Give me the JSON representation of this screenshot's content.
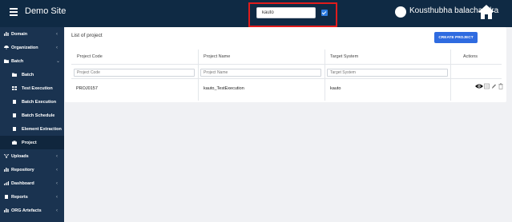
{
  "header": {
    "app_title": "Demo Site",
    "search": {
      "value": "kauto",
      "placeholder": ""
    },
    "checkbox_checked": true,
    "username": "Kousthubha balachandra"
  },
  "sidebar": {
    "items": [
      {
        "label": "Domain",
        "icon": "bar-chart-icon",
        "chevron": "‹"
      },
      {
        "label": "Organization",
        "icon": "umbrella-icon",
        "chevron": "‹"
      },
      {
        "label": "Batch",
        "icon": "folder-icon",
        "chevron": "⌄"
      },
      {
        "label": "Batch",
        "icon": "folder-icon"
      },
      {
        "label": "Test Execution",
        "icon": "grid-icon"
      },
      {
        "label": "Batch Execution",
        "icon": "document-icon"
      },
      {
        "label": "Batch Schedule",
        "icon": "document-icon"
      },
      {
        "label": "Element Extraction",
        "icon": "document-icon"
      },
      {
        "label": "Project",
        "icon": "briefcase-icon"
      },
      {
        "label": "Uploads",
        "icon": "filter-icon",
        "chevron": "‹"
      },
      {
        "label": "Repository",
        "icon": "bar-chart-icon",
        "chevron": "‹"
      },
      {
        "label": "Dashboard",
        "icon": "line-chart-icon",
        "chevron": "‹"
      },
      {
        "label": "Reports",
        "icon": "document-icon",
        "chevron": "‹"
      },
      {
        "label": "ORG Artefacts",
        "icon": "bar-chart-icon",
        "chevron": "‹"
      }
    ]
  },
  "main": {
    "title": "List of project",
    "create_button": "CREATE PROJECT",
    "columns": [
      "Project Code",
      "Project Name",
      "Target System",
      "Actions"
    ],
    "filters": [
      {
        "placeholder": "Project Code"
      },
      {
        "placeholder": "Project Name"
      },
      {
        "placeholder": "Target System"
      }
    ],
    "rows": [
      {
        "code": "PROJ0157",
        "name": "kauto_TestExecution",
        "target": "kauto"
      }
    ],
    "actions": [
      "eye-icon",
      "list-icon",
      "pencil-icon",
      "trash-icon"
    ]
  },
  "colors": {
    "topbar": "#0f2a44",
    "sidebar": "#1a3350",
    "accent": "#2f6be0",
    "highlight": "#e01c1c"
  }
}
